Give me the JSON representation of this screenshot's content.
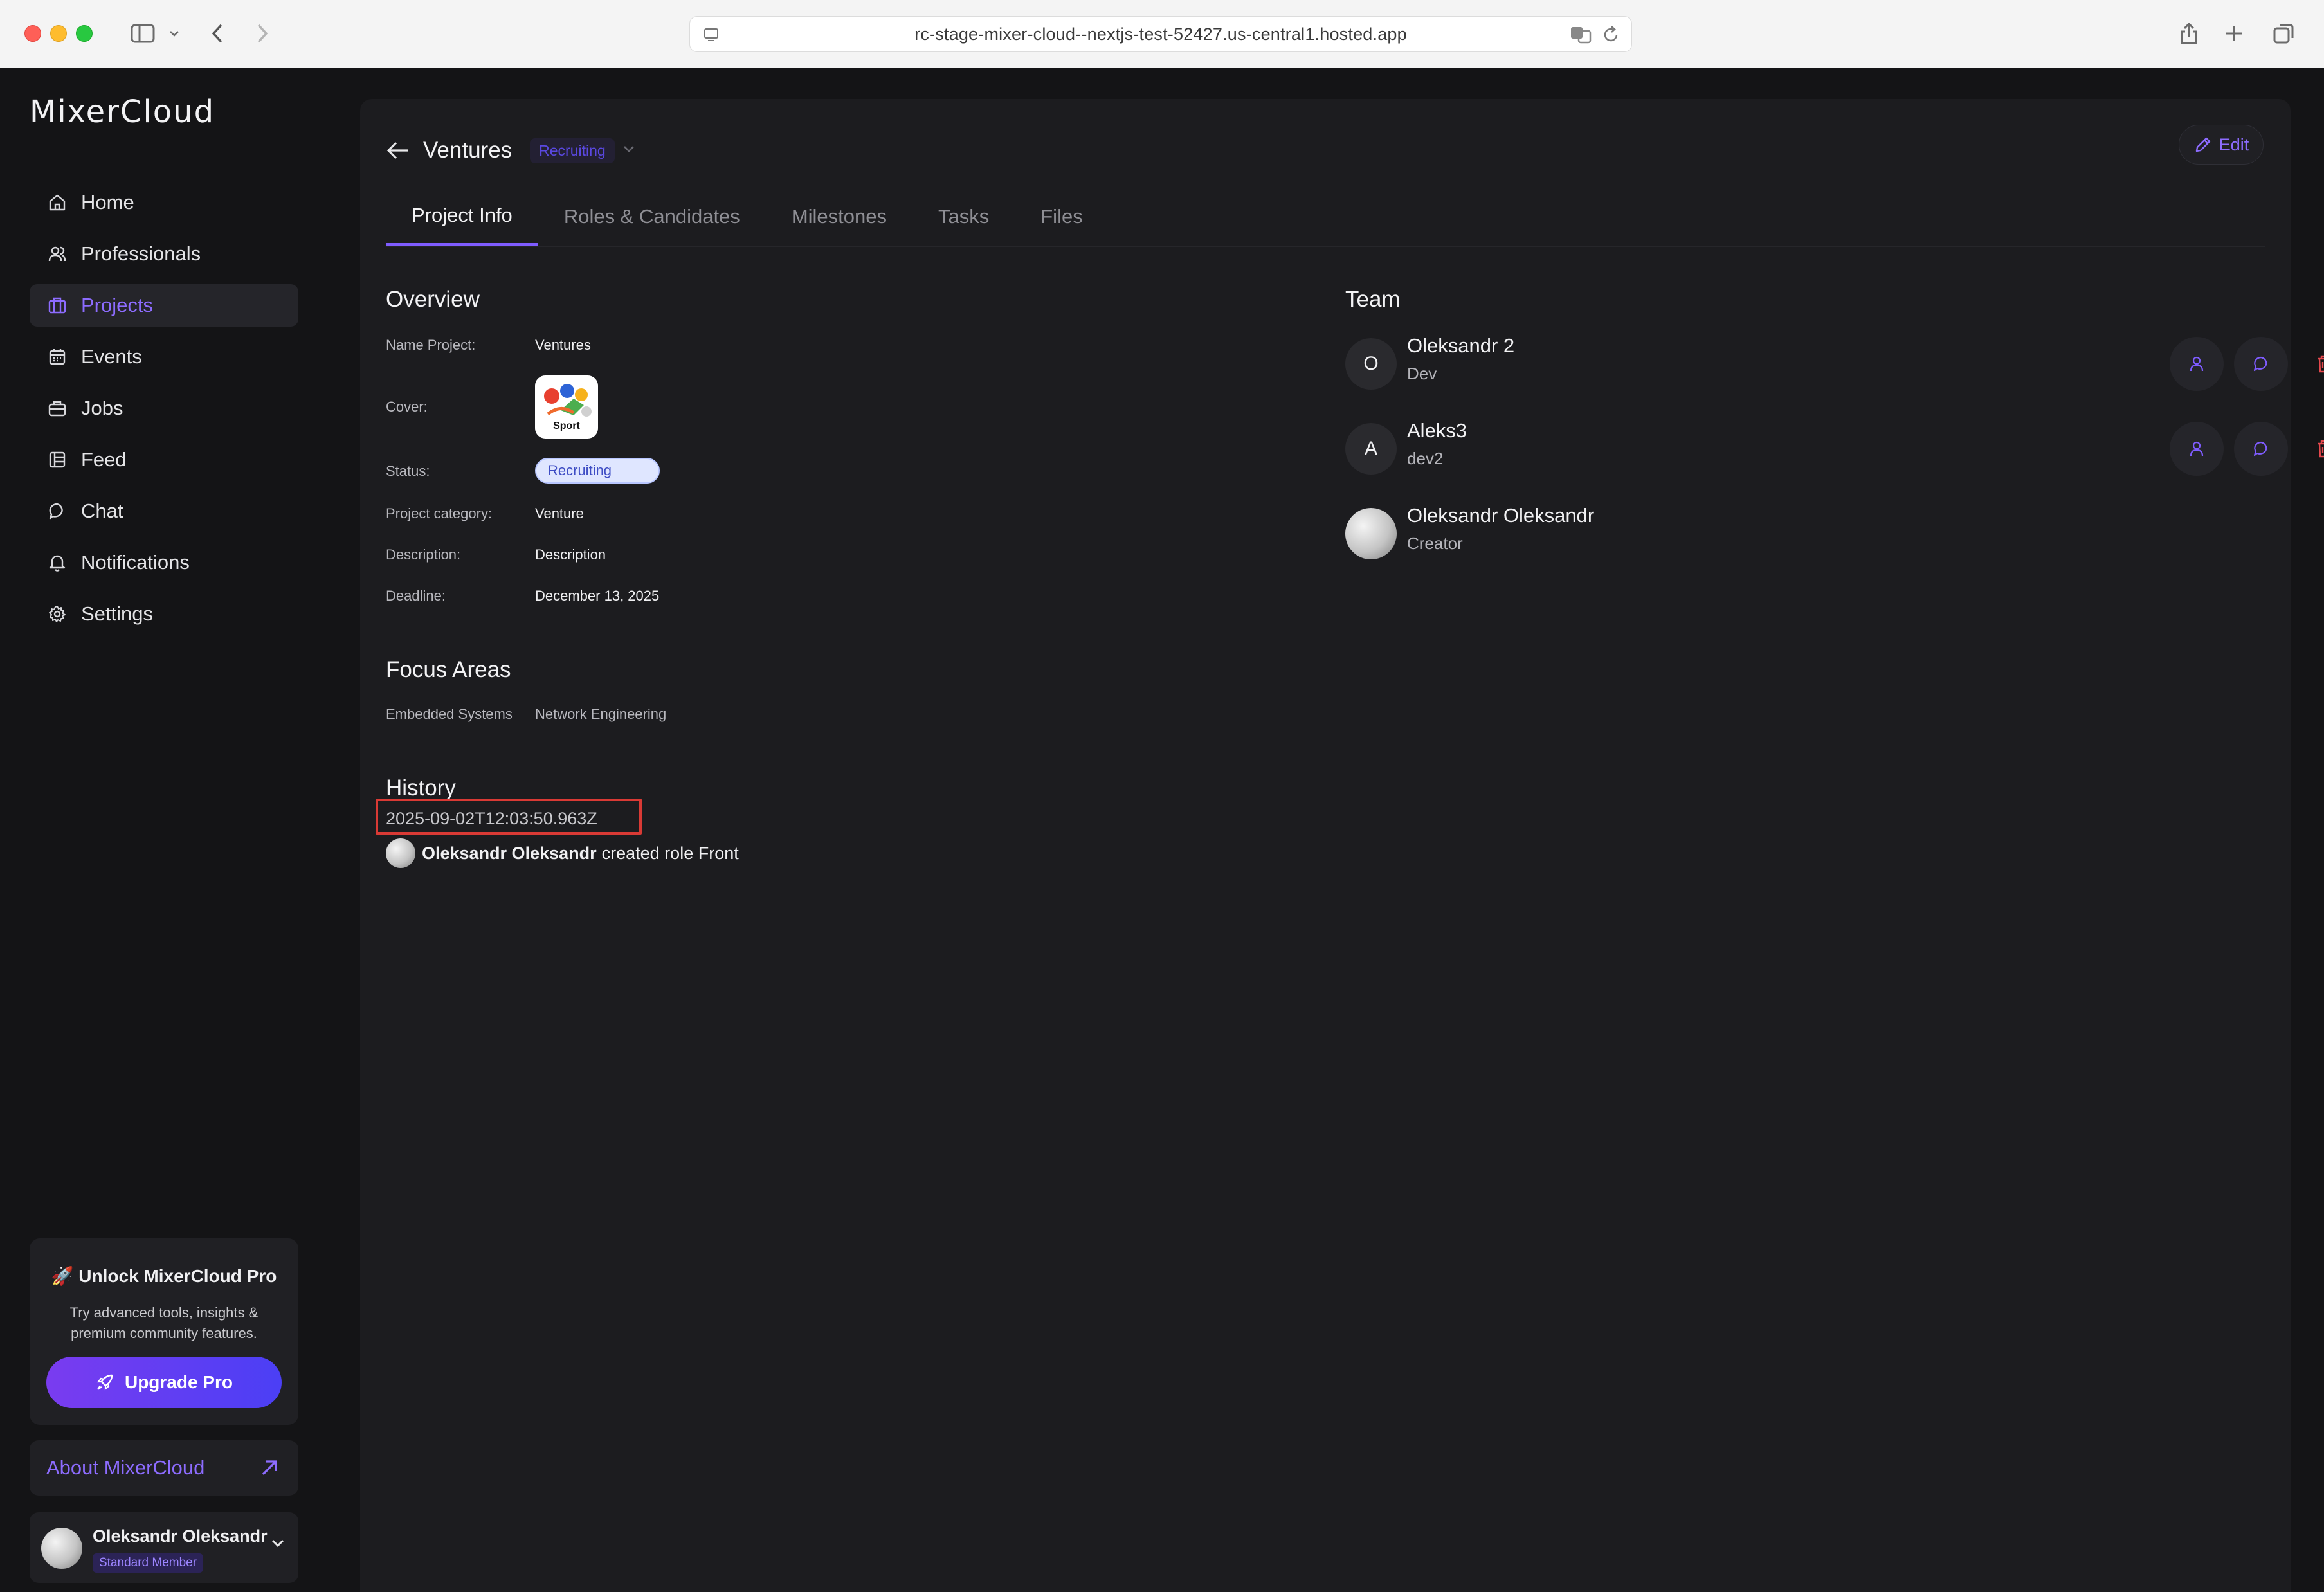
{
  "browser": {
    "url": "rc-stage-mixer-cloud--nextjs-test-52427.us-central1.hosted.app"
  },
  "sidebar": {
    "logo": "MixerCloud",
    "items": [
      {
        "label": "Home",
        "icon": "home-icon"
      },
      {
        "label": "Professionals",
        "icon": "users-icon"
      },
      {
        "label": "Projects",
        "icon": "projects-icon",
        "active": true
      },
      {
        "label": "Events",
        "icon": "calendar-icon"
      },
      {
        "label": "Jobs",
        "icon": "briefcase-icon"
      },
      {
        "label": "Feed",
        "icon": "feed-icon"
      },
      {
        "label": "Chat",
        "icon": "chat-icon"
      },
      {
        "label": "Notifications",
        "icon": "bell-icon"
      },
      {
        "label": "Settings",
        "icon": "gear-icon"
      }
    ],
    "promo": {
      "title": "🚀 Unlock MixerCloud Pro",
      "text": "Try advanced tools, insights & premium community features.",
      "button": "Upgrade Pro"
    },
    "about": "About MixerCloud",
    "user": {
      "name": "Oleksandr Oleksandr",
      "badge": "Standard Member"
    }
  },
  "header": {
    "title": "Ventures",
    "status": "Recruiting",
    "edit": "Edit"
  },
  "tabs": [
    "Project Info",
    "Roles & Candidates",
    "Milestones",
    "Tasks",
    "Files"
  ],
  "overview": {
    "title": "Overview",
    "fields": {
      "name_label": "Name Project:",
      "name_value": "Ventures",
      "cover_label": "Cover:",
      "cover_text": "Sport",
      "status_label": "Status:",
      "status_value": "Recruiting",
      "category_label": "Project category:",
      "category_value": "Venture",
      "description_label": "Description:",
      "description_value": "Description",
      "deadline_label": "Deadline:",
      "deadline_value": "December 13, 2025"
    }
  },
  "focus": {
    "title": "Focus Areas",
    "areas": [
      "Embedded Systems",
      "Network Engineering"
    ]
  },
  "history": {
    "title": "History",
    "date": "2025-09-02T12:03:50.963Z",
    "actor": "Oleksandr Oleksandr",
    "action": "created role Front"
  },
  "team": {
    "title": "Team",
    "members": [
      {
        "initial": "O",
        "name": "Oleksandr 2",
        "role": "Dev"
      },
      {
        "initial": "A",
        "name": "Aleks3",
        "role": "dev2"
      },
      {
        "initial": "",
        "name": "Oleksandr Oleksandr",
        "role": "Creator"
      }
    ]
  },
  "colors": {
    "accent": "#8d6cff",
    "danger": "#e5484d",
    "background": "#141416",
    "panel": "#1c1c1f"
  }
}
